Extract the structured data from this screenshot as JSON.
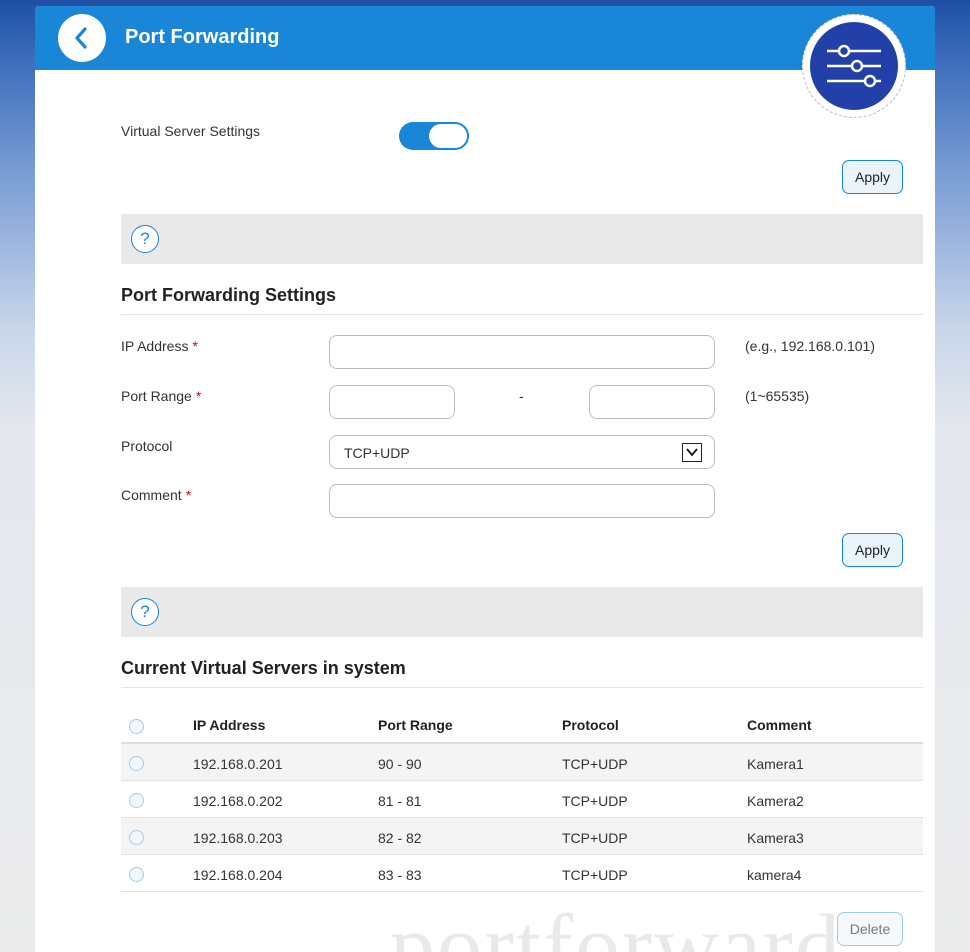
{
  "header": {
    "title": "Port Forwarding",
    "back_icon": "chevron-left-icon",
    "badge_icon": "sliders-icon"
  },
  "virtual_server": {
    "label": "Virtual Server Settings",
    "enabled": true,
    "apply_label": "Apply"
  },
  "help": {
    "symbol": "?"
  },
  "settings": {
    "title": "Port Forwarding Settings",
    "required_mark": "*",
    "ip": {
      "label": "IP Address",
      "value": "",
      "hint": "(e.g., 192.168.0.101)"
    },
    "port_range": {
      "label": "Port Range",
      "start": "",
      "end": "",
      "separator": "-",
      "hint": "(1~65535)"
    },
    "protocol": {
      "label": "Protocol",
      "selected": "TCP+UDP"
    },
    "comment": {
      "label": "Comment",
      "value": ""
    },
    "apply_label": "Apply"
  },
  "servers": {
    "title": "Current Virtual Servers in system",
    "columns": [
      "IP Address",
      "Port Range",
      "Protocol",
      "Comment"
    ],
    "rows": [
      [
        "192.168.0.201",
        "90 - 90",
        "TCP+UDP",
        "Kamera1"
      ],
      [
        "192.168.0.202",
        "81 - 81",
        "TCP+UDP",
        "Kamera2"
      ],
      [
        "192.168.0.203",
        "82 - 82",
        "TCP+UDP",
        "Kamera3"
      ],
      [
        "192.168.0.204",
        "83 - 83",
        "TCP+UDP",
        "kamera4"
      ]
    ],
    "delete_label": "Delete"
  },
  "watermark": "portforward",
  "colors": {
    "accent": "#1a86d8",
    "badge": "#2340a8",
    "required": "#d0021b"
  }
}
